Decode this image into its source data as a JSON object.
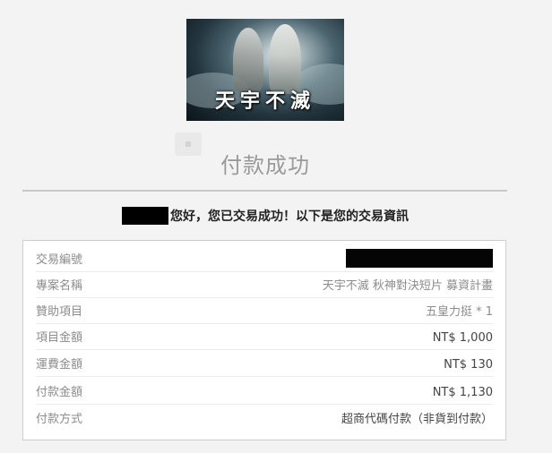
{
  "banner": {
    "title": "天宇不滅"
  },
  "page_title": "付款成功",
  "greeting": "您好，您已交易成功！以下是您的交易資訊",
  "details": [
    {
      "label": "交易編號",
      "value": ""
    },
    {
      "label": "專案名稱",
      "value": "天宇不滅 秋神對決短片 募資計畫"
    },
    {
      "label": "贊助項目",
      "value": "五皇力挺 * 1"
    },
    {
      "label": "項目金額",
      "value": "NT$ 1,000"
    },
    {
      "label": "運費金額",
      "value": "NT$ 130"
    },
    {
      "label": "付款金額",
      "value": "NT$ 1,130"
    },
    {
      "label": "付款方式",
      "value": "超商代碼付款（非貨到付款）"
    }
  ]
}
